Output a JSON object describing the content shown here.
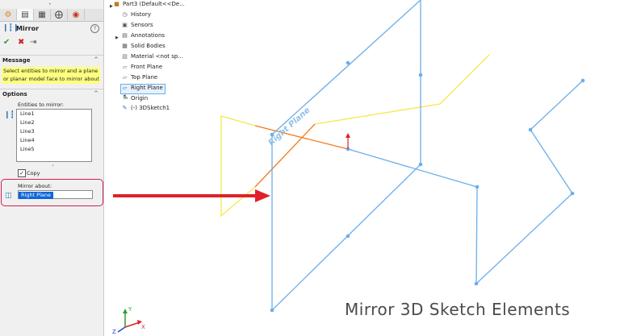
{
  "property_manager": {
    "tabs": [
      {
        "icon": "feature-manager-icon"
      },
      {
        "icon": "property-manager-icon"
      },
      {
        "icon": "configuration-manager-icon"
      },
      {
        "icon": "dimxpert-icon"
      },
      {
        "icon": "display-manager-icon"
      }
    ],
    "title": "Mirror",
    "help_symbol": "?",
    "actions": {
      "ok": "✔",
      "cancel": "✖",
      "pin": "⇥"
    },
    "message_section": {
      "label": "Message",
      "text_line1": "Select entities to mirror and a plane",
      "text_line2": "or planar model face to mirror about"
    },
    "options_section": {
      "label": "Options",
      "entities_label": "Entities to mirror:",
      "entities": [
        "Line1",
        "Line2",
        "Line3",
        "Line4",
        "Line5"
      ],
      "copy_label": "Copy",
      "copy_checked": true,
      "mirror_about_label": "Mirror about:",
      "mirror_about_value": "Right Plane"
    },
    "collapse_symbol": "^",
    "highlight_color": "#d12052"
  },
  "feature_tree": {
    "root": "Part3  (Default<<De...",
    "items": [
      {
        "label": "History",
        "icon": "history-icon"
      },
      {
        "label": "Sensors",
        "icon": "sensors-icon"
      },
      {
        "label": "Annotations",
        "icon": "annotations-icon"
      },
      {
        "label": "Solid Bodies",
        "icon": "solid-bodies-icon"
      },
      {
        "label": "Material <not sp...",
        "icon": "material-icon"
      },
      {
        "label": "Front Plane",
        "icon": "plane-icon"
      },
      {
        "label": "Top Plane",
        "icon": "plane-icon"
      },
      {
        "label": "Right Plane",
        "icon": "plane-icon"
      },
      {
        "label": "Origin",
        "icon": "origin-icon"
      },
      {
        "label": "(-) 3DSketch1",
        "icon": "sketch-icon"
      }
    ]
  },
  "graphics": {
    "plane_label": "Right Plane",
    "colors": {
      "sketch_blue": "#6aaeea",
      "plane_yellow": "#f5e84a",
      "orange": "#f07b1c",
      "arrow_red": "#e0202a",
      "label_blue": "#8ec0ec"
    },
    "triad": {
      "x": "X",
      "y": "Y",
      "z": "Z"
    }
  },
  "caption": "Mirror 3D Sketch Elements"
}
